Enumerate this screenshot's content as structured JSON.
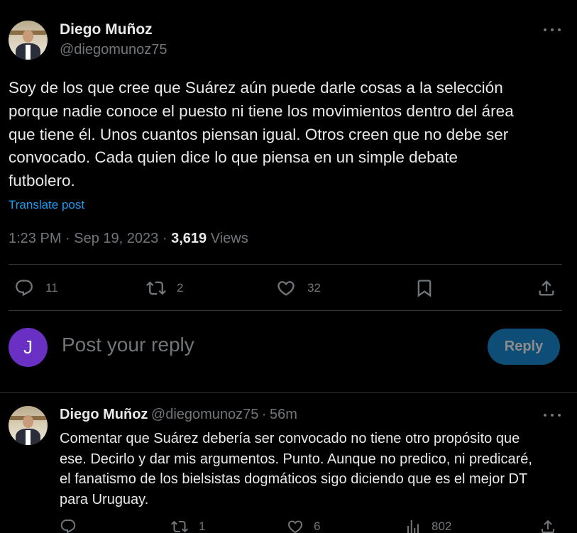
{
  "post": {
    "author_name": "Diego Muñoz",
    "author_handle": "@diegomunoz75",
    "more_icon": "more-icon",
    "text": "Soy de los que cree que Suárez aún puede darle cosas a la selección\nporque nadie conoce el puesto ni tiene los movimientos dentro del área\nque tiene él. Unos cuantos piensan igual. Otros creen que no debe ser\nconvocado. Cada quien dice lo que piensa en un simple debate\nfutbolero.",
    "translate_label": "Translate post",
    "time": "1:23 PM",
    "date": "Sep 19, 2023",
    "separator": "·",
    "views_count": "3,619",
    "views_label": "Views",
    "actions": {
      "reply_count": "11",
      "repost_count": "2",
      "like_count": "32"
    }
  },
  "composer": {
    "avatar_letter": "J",
    "placeholder": "Post your reply",
    "button_label": "Reply",
    "avatar_color": "#6a2fc3"
  },
  "reply": {
    "author_name": "Diego Muñoz",
    "author_handle": "@diegomunoz75",
    "separator": "·",
    "time_ago": "56m",
    "text": "Comentar que Suárez debería ser convocado no tiene otro propósito que\nese. Decirlo y dar mis argumentos. Punto. Aunque no predico, ni predicaré,\nel fanatismo de los bielsistas dogmáticos sigo diciendo que es el mejor DT\npara Uruguay.",
    "actions": {
      "reply_count": "",
      "repost_count": "1",
      "like_count": "6",
      "views_count": "802"
    }
  },
  "colors": {
    "background": "#000000",
    "text_primary": "#e7e9ea",
    "text_secondary": "#71767b",
    "link": "#1d9bf0",
    "divider": "#2f3336",
    "accent_button": "#1a8cd8"
  }
}
